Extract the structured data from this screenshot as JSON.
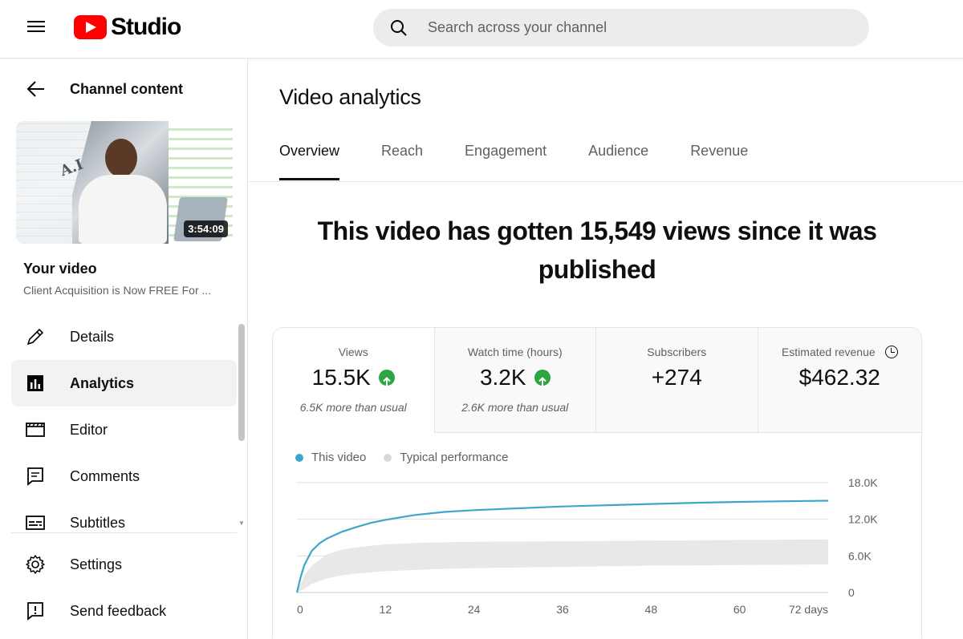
{
  "header": {
    "brand": "Studio",
    "search_placeholder": "Search across your channel"
  },
  "sidebar": {
    "back_label": "Channel content",
    "thumbnail": {
      "duration": "3:54:09",
      "overlay_text": "A.I"
    },
    "your_video_label": "Your video",
    "video_title": "Client Acquisition is Now FREE For ...",
    "items": [
      {
        "label": "Details",
        "icon": "pencil-icon"
      },
      {
        "label": "Analytics",
        "icon": "analytics-icon",
        "active": true
      },
      {
        "label": "Editor",
        "icon": "clapperboard-icon"
      },
      {
        "label": "Comments",
        "icon": "comment-icon"
      },
      {
        "label": "Subtitles",
        "icon": "subtitles-icon"
      }
    ],
    "bottom_items": [
      {
        "label": "Settings",
        "icon": "gear-icon"
      },
      {
        "label": "Send feedback",
        "icon": "feedback-icon"
      }
    ]
  },
  "main": {
    "title": "Video analytics",
    "tabs": [
      "Overview",
      "Reach",
      "Engagement",
      "Audience",
      "Revenue"
    ],
    "active_tab": "Overview",
    "headline": "This video has gotten 15,549 views since it was published",
    "metrics": [
      {
        "label": "Views",
        "value": "15.5K",
        "trend": "up",
        "note": "6.5K more than usual"
      },
      {
        "label": "Watch time (hours)",
        "value": "3.2K",
        "trend": "up",
        "note": "2.6K more than usual"
      },
      {
        "label": "Subscribers",
        "value": "+274",
        "note": ""
      },
      {
        "label": "Estimated revenue",
        "value": "$462.32",
        "note": ""
      }
    ],
    "legend": {
      "this_video": "This video",
      "typical": "Typical performance"
    }
  },
  "colors": {
    "accent_red": "#ff0000",
    "line_blue": "#3ea6c9",
    "band_gray": "#e8e8e8",
    "up_green": "#2ba640"
  },
  "chart_data": {
    "type": "line",
    "x_ticks": [
      "0",
      "12",
      "24",
      "36",
      "48",
      "60",
      "72 days"
    ],
    "y_ticks": [
      "0",
      "6.0K",
      "12.0K",
      "18.0K"
    ],
    "xlim": [
      0,
      72
    ],
    "ylim": [
      0,
      18000
    ],
    "series": [
      {
        "name": "This video",
        "x": [
          0,
          0.5,
          1,
          2,
          3,
          4,
          6,
          8,
          10,
          12,
          16,
          20,
          24,
          30,
          36,
          42,
          48,
          54,
          60,
          66,
          72
        ],
        "y": [
          0,
          2500,
          4500,
          6800,
          8000,
          8800,
          9900,
          10700,
          11400,
          11900,
          12700,
          13200,
          13500,
          13800,
          14100,
          14300,
          14500,
          14700,
          14850,
          14950,
          15050
        ]
      }
    ],
    "band": {
      "name": "Typical performance",
      "x": [
        0,
        1,
        2,
        4,
        6,
        8,
        12,
        18,
        24,
        36,
        48,
        60,
        72
      ],
      "low": [
        0,
        600,
        1400,
        2300,
        2800,
        3100,
        3500,
        3800,
        4000,
        4200,
        4400,
        4500,
        4600
      ],
      "high": [
        0,
        2800,
        4400,
        6200,
        7000,
        7400,
        7900,
        8200,
        8300,
        8400,
        8500,
        8600,
        8700
      ]
    }
  }
}
